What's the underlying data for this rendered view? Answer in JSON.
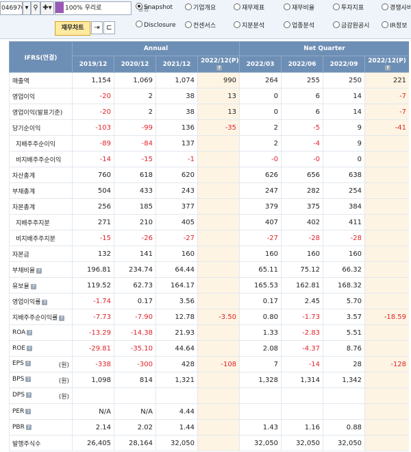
{
  "toolbar": {
    "code": "046970",
    "company": "100% 우리로",
    "setting_label": "설정",
    "fin_chart_button": "재무차트",
    "tabs_row1": [
      {
        "label": "Snapshot",
        "selected": true
      },
      {
        "label": "기업개요",
        "selected": false
      },
      {
        "label": "재무제표",
        "selected": false
      },
      {
        "label": "재무비율",
        "selected": false
      },
      {
        "label": "투자지표",
        "selected": false
      },
      {
        "label": "경쟁사비",
        "selected": false
      }
    ],
    "tabs_row2": [
      {
        "label": "Disclosure",
        "selected": false
      },
      {
        "label": "컨센서스",
        "selected": false
      },
      {
        "label": "지분분석",
        "selected": false
      },
      {
        "label": "업종분석",
        "selected": false
      },
      {
        "label": "금감원공시",
        "selected": false
      },
      {
        "label": "IR정보",
        "selected": false
      }
    ]
  },
  "table": {
    "corner": "IFRS(연결)",
    "group_annual": "Annual",
    "group_quarter": "Net Quarter",
    "columns": [
      {
        "label": "2019/12",
        "estimate": false
      },
      {
        "label": "2020/12",
        "estimate": false
      },
      {
        "label": "2021/12",
        "estimate": false
      },
      {
        "label": "2022/12(P)",
        "estimate": true
      },
      {
        "label": "2022/03",
        "estimate": false
      },
      {
        "label": "2022/06",
        "estimate": false
      },
      {
        "label": "2022/09",
        "estimate": false
      },
      {
        "label": "2022/12(P)",
        "estimate": true
      }
    ],
    "rows": [
      {
        "label": "매출액",
        "indent": false,
        "icon": false,
        "unit": "",
        "values": [
          "1,154",
          "1,069",
          "1,074",
          "990",
          "264",
          "255",
          "250",
          "221"
        ]
      },
      {
        "label": "영업이익",
        "indent": false,
        "icon": false,
        "unit": "",
        "values": [
          "-20",
          "2",
          "38",
          "13",
          "0",
          "6",
          "14",
          "-7"
        ]
      },
      {
        "label": "영업이익(발표기준)",
        "indent": false,
        "icon": false,
        "unit": "",
        "values": [
          "-20",
          "2",
          "38",
          "13",
          "0",
          "6",
          "14",
          "-7"
        ]
      },
      {
        "label": "당기순이익",
        "indent": false,
        "icon": false,
        "unit": "",
        "values": [
          "-103",
          "-99",
          "136",
          "-35",
          "2",
          "-5",
          "9",
          "-41"
        ]
      },
      {
        "label": "지배주주순이익",
        "indent": true,
        "icon": false,
        "unit": "",
        "values": [
          "-89",
          "-84",
          "137",
          "",
          "2",
          "-4",
          "9",
          ""
        ]
      },
      {
        "label": "비지배주주순이익",
        "indent": true,
        "icon": false,
        "unit": "",
        "values": [
          "-14",
          "-15",
          "-1",
          "",
          "-0",
          "-0",
          "0",
          ""
        ]
      },
      {
        "label": "자산총계",
        "indent": false,
        "icon": false,
        "unit": "",
        "values": [
          "760",
          "618",
          "620",
          "",
          "626",
          "656",
          "638",
          ""
        ]
      },
      {
        "label": "부채총계",
        "indent": false,
        "icon": false,
        "unit": "",
        "values": [
          "504",
          "433",
          "243",
          "",
          "247",
          "282",
          "254",
          ""
        ]
      },
      {
        "label": "자본총계",
        "indent": false,
        "icon": false,
        "unit": "",
        "values": [
          "256",
          "185",
          "377",
          "",
          "379",
          "375",
          "384",
          ""
        ]
      },
      {
        "label": "지배주주지분",
        "indent": true,
        "icon": false,
        "unit": "",
        "values": [
          "271",
          "210",
          "405",
          "",
          "407",
          "402",
          "411",
          ""
        ]
      },
      {
        "label": "비지배주주지분",
        "indent": true,
        "icon": false,
        "unit": "",
        "values": [
          "-15",
          "-26",
          "-27",
          "",
          "-27",
          "-28",
          "-28",
          ""
        ]
      },
      {
        "label": "자본금",
        "indent": false,
        "icon": false,
        "unit": "",
        "values": [
          "132",
          "141",
          "160",
          "",
          "160",
          "160",
          "160",
          ""
        ]
      },
      {
        "label": "부채비율",
        "indent": false,
        "icon": true,
        "unit": "",
        "values": [
          "196.81",
          "234.74",
          "64.44",
          "",
          "65.11",
          "75.12",
          "66.32",
          ""
        ]
      },
      {
        "label": "유보율",
        "indent": false,
        "icon": true,
        "unit": "",
        "values": [
          "119.52",
          "62.73",
          "164.17",
          "",
          "165.53",
          "162.81",
          "168.32",
          ""
        ]
      },
      {
        "label": "영업이익률",
        "indent": false,
        "icon": true,
        "unit": "",
        "values": [
          "-1.74",
          "0.17",
          "3.56",
          "",
          "0.17",
          "2.45",
          "5.70",
          ""
        ]
      },
      {
        "label": "지배주주순이익률",
        "indent": false,
        "icon": true,
        "unit": "",
        "values": [
          "-7.73",
          "-7.90",
          "12.78",
          "-3.50",
          "0.80",
          "-1.73",
          "3.57",
          "-18.59"
        ]
      },
      {
        "label": "ROA",
        "indent": false,
        "icon": true,
        "unit": "",
        "values": [
          "-13.29",
          "-14.38",
          "21.93",
          "",
          "1.33",
          "-2.83",
          "5.51",
          ""
        ]
      },
      {
        "label": "ROE",
        "indent": false,
        "icon": true,
        "unit": "",
        "values": [
          "-29.81",
          "-35.10",
          "44.64",
          "",
          "2.08",
          "-4.37",
          "8.76",
          ""
        ]
      },
      {
        "label": "EPS",
        "indent": false,
        "icon": true,
        "unit": "(원)",
        "values": [
          "-338",
          "-300",
          "428",
          "-108",
          "7",
          "-14",
          "28",
          "-128"
        ]
      },
      {
        "label": "BPS",
        "indent": false,
        "icon": true,
        "unit": "(원)",
        "values": [
          "1,098",
          "814",
          "1,321",
          "",
          "1,328",
          "1,314",
          "1,342",
          ""
        ]
      },
      {
        "label": "DPS",
        "indent": false,
        "icon": true,
        "unit": "(원)",
        "values": [
          "",
          "",
          "",
          "",
          "",
          "",
          "",
          ""
        ]
      },
      {
        "label": "PER",
        "indent": false,
        "icon": true,
        "unit": "",
        "values": [
          "N/A",
          "N/A",
          "4.44",
          "",
          "",
          "",
          "",
          ""
        ]
      },
      {
        "label": "PBR",
        "indent": false,
        "icon": true,
        "unit": "",
        "values": [
          "2.14",
          "2.02",
          "1.44",
          "",
          "1.43",
          "1.16",
          "0.88",
          ""
        ]
      },
      {
        "label": "발행주식수",
        "indent": false,
        "icon": false,
        "unit": "",
        "values": [
          "26,405",
          "28,164",
          "32,050",
          "",
          "32,050",
          "32,050",
          "32,050",
          ""
        ]
      }
    ]
  }
}
